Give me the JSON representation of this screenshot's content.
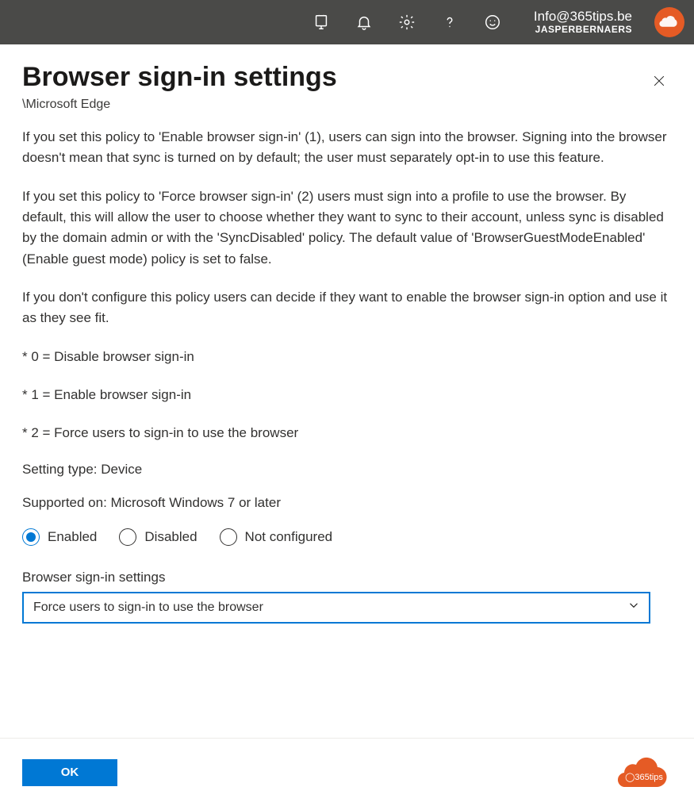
{
  "header": {
    "user_email": "Info@365tips.be",
    "tenant": "JASPERBERNAERS"
  },
  "panel": {
    "title": "Browser sign-in settings",
    "breadcrumb": "\\Microsoft Edge"
  },
  "description": {
    "p1": "If you set this policy to 'Enable browser sign-in' (1), users can sign into the browser. Signing into the browser doesn't mean that sync is turned on by default; the user must separately opt-in to use this feature.",
    "p2": "If you set this policy to 'Force browser sign-in' (2) users must sign into a profile to use the browser. By default, this will allow the user to choose whether they want to sync to their account, unless sync is disabled by the domain admin or with the 'SyncDisabled' policy. The default value of 'BrowserGuestModeEnabled' (Enable guest mode) policy is set to false.",
    "p3": "If you don't configure this policy users can decide if they want to enable the browser sign-in option and use it as they see fit.",
    "opt0": "* 0 = Disable browser sign-in",
    "opt1": "* 1 = Enable browser sign-in",
    "opt2": "* 2 = Force users to sign-in to use the browser",
    "setting_type": "Setting type: Device",
    "supported_on": "Supported on: Microsoft Windows 7 or later"
  },
  "radios": {
    "enabled": "Enabled",
    "disabled": "Disabled",
    "not_configured": "Not configured",
    "selected": "enabled"
  },
  "dropdown": {
    "label": "Browser sign-in settings",
    "value": "Force users to sign-in to use the browser"
  },
  "footer": {
    "ok": "OK",
    "brand": "365tips"
  },
  "colors": {
    "accent": "#0078d4",
    "brand": "#e55b25",
    "topbar": "#4a4a48"
  }
}
